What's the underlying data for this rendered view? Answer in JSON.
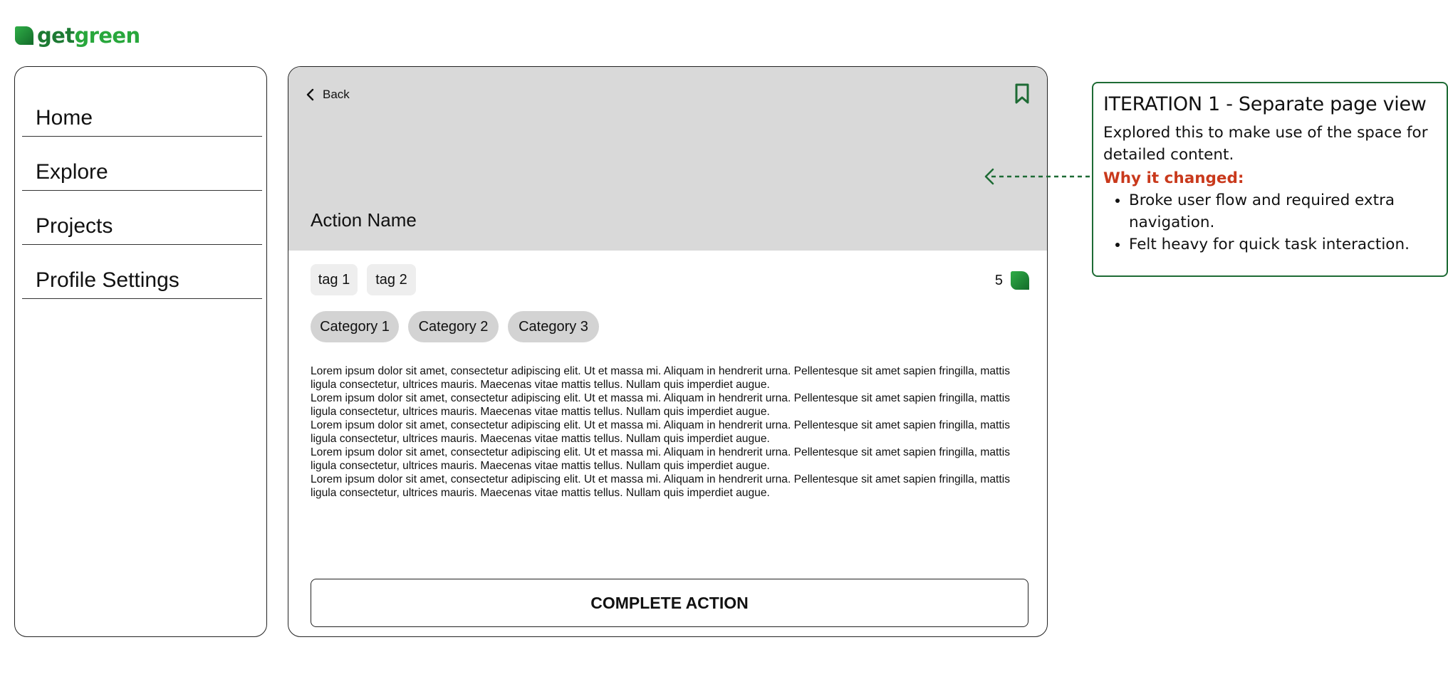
{
  "brand": {
    "name_part1": "get",
    "name_part2": "green",
    "color_dark": "#1d7a33",
    "color_light": "#28a73c",
    "icon": "leaf-icon"
  },
  "sidebar": {
    "items": [
      {
        "label": "Home"
      },
      {
        "label": "Explore"
      },
      {
        "label": "Projects"
      },
      {
        "label": "Profile Settings"
      }
    ]
  },
  "detail": {
    "back_label": "Back",
    "bookmark_icon": "bookmark-icon",
    "title": "Action Name",
    "tags": [
      "tag 1",
      "tag 2"
    ],
    "points": "5",
    "categories": [
      "Category 1",
      "Category 2",
      "Category 3"
    ],
    "paragraphs": [
      "Lorem ipsum dolor sit amet, consectetur adipiscing elit. Ut et massa mi. Aliquam in hendrerit urna. Pellentesque sit amet sapien fringilla, mattis ligula consectetur, ultrices mauris. Maecenas vitae mattis tellus. Nullam quis imperdiet augue.",
      "Lorem ipsum dolor sit amet, consectetur adipiscing elit. Ut et massa mi. Aliquam in hendrerit urna. Pellentesque sit amet sapien fringilla, mattis ligula consectetur, ultrices mauris. Maecenas vitae mattis tellus. Nullam quis imperdiet augue.",
      "Lorem ipsum dolor sit amet, consectetur adipiscing elit. Ut et massa mi. Aliquam in hendrerit urna. Pellentesque sit amet sapien fringilla, mattis ligula consectetur, ultrices mauris. Maecenas vitae mattis tellus. Nullam quis imperdiet augue.",
      "Lorem ipsum dolor sit amet, consectetur adipiscing elit. Ut et massa mi. Aliquam in hendrerit urna. Pellentesque sit amet sapien fringilla, mattis ligula consectetur, ultrices mauris. Maecenas vitae mattis tellus. Nullam quis imperdiet augue.",
      "Lorem ipsum dolor sit amet, consectetur adipiscing elit. Ut et massa mi. Aliquam in hendrerit urna. Pellentesque sit amet sapien fringilla, mattis ligula consectetur, ultrices mauris. Maecenas vitae mattis tellus. Nullam quis imperdiet augue."
    ],
    "complete_label": "COMPLETE ACTION",
    "hero_color": "#d9d9d9"
  },
  "annotation": {
    "title": "ITERATION 1 - Separate page view",
    "description": "Explored this to make use of the space for detailed content.",
    "why_label": "Why it changed:",
    "reasons": [
      "Broke user flow and required extra navigation.",
      "Felt heavy for quick task interaction."
    ],
    "border_color": "#1e6b35",
    "why_color": "#c9391c"
  }
}
